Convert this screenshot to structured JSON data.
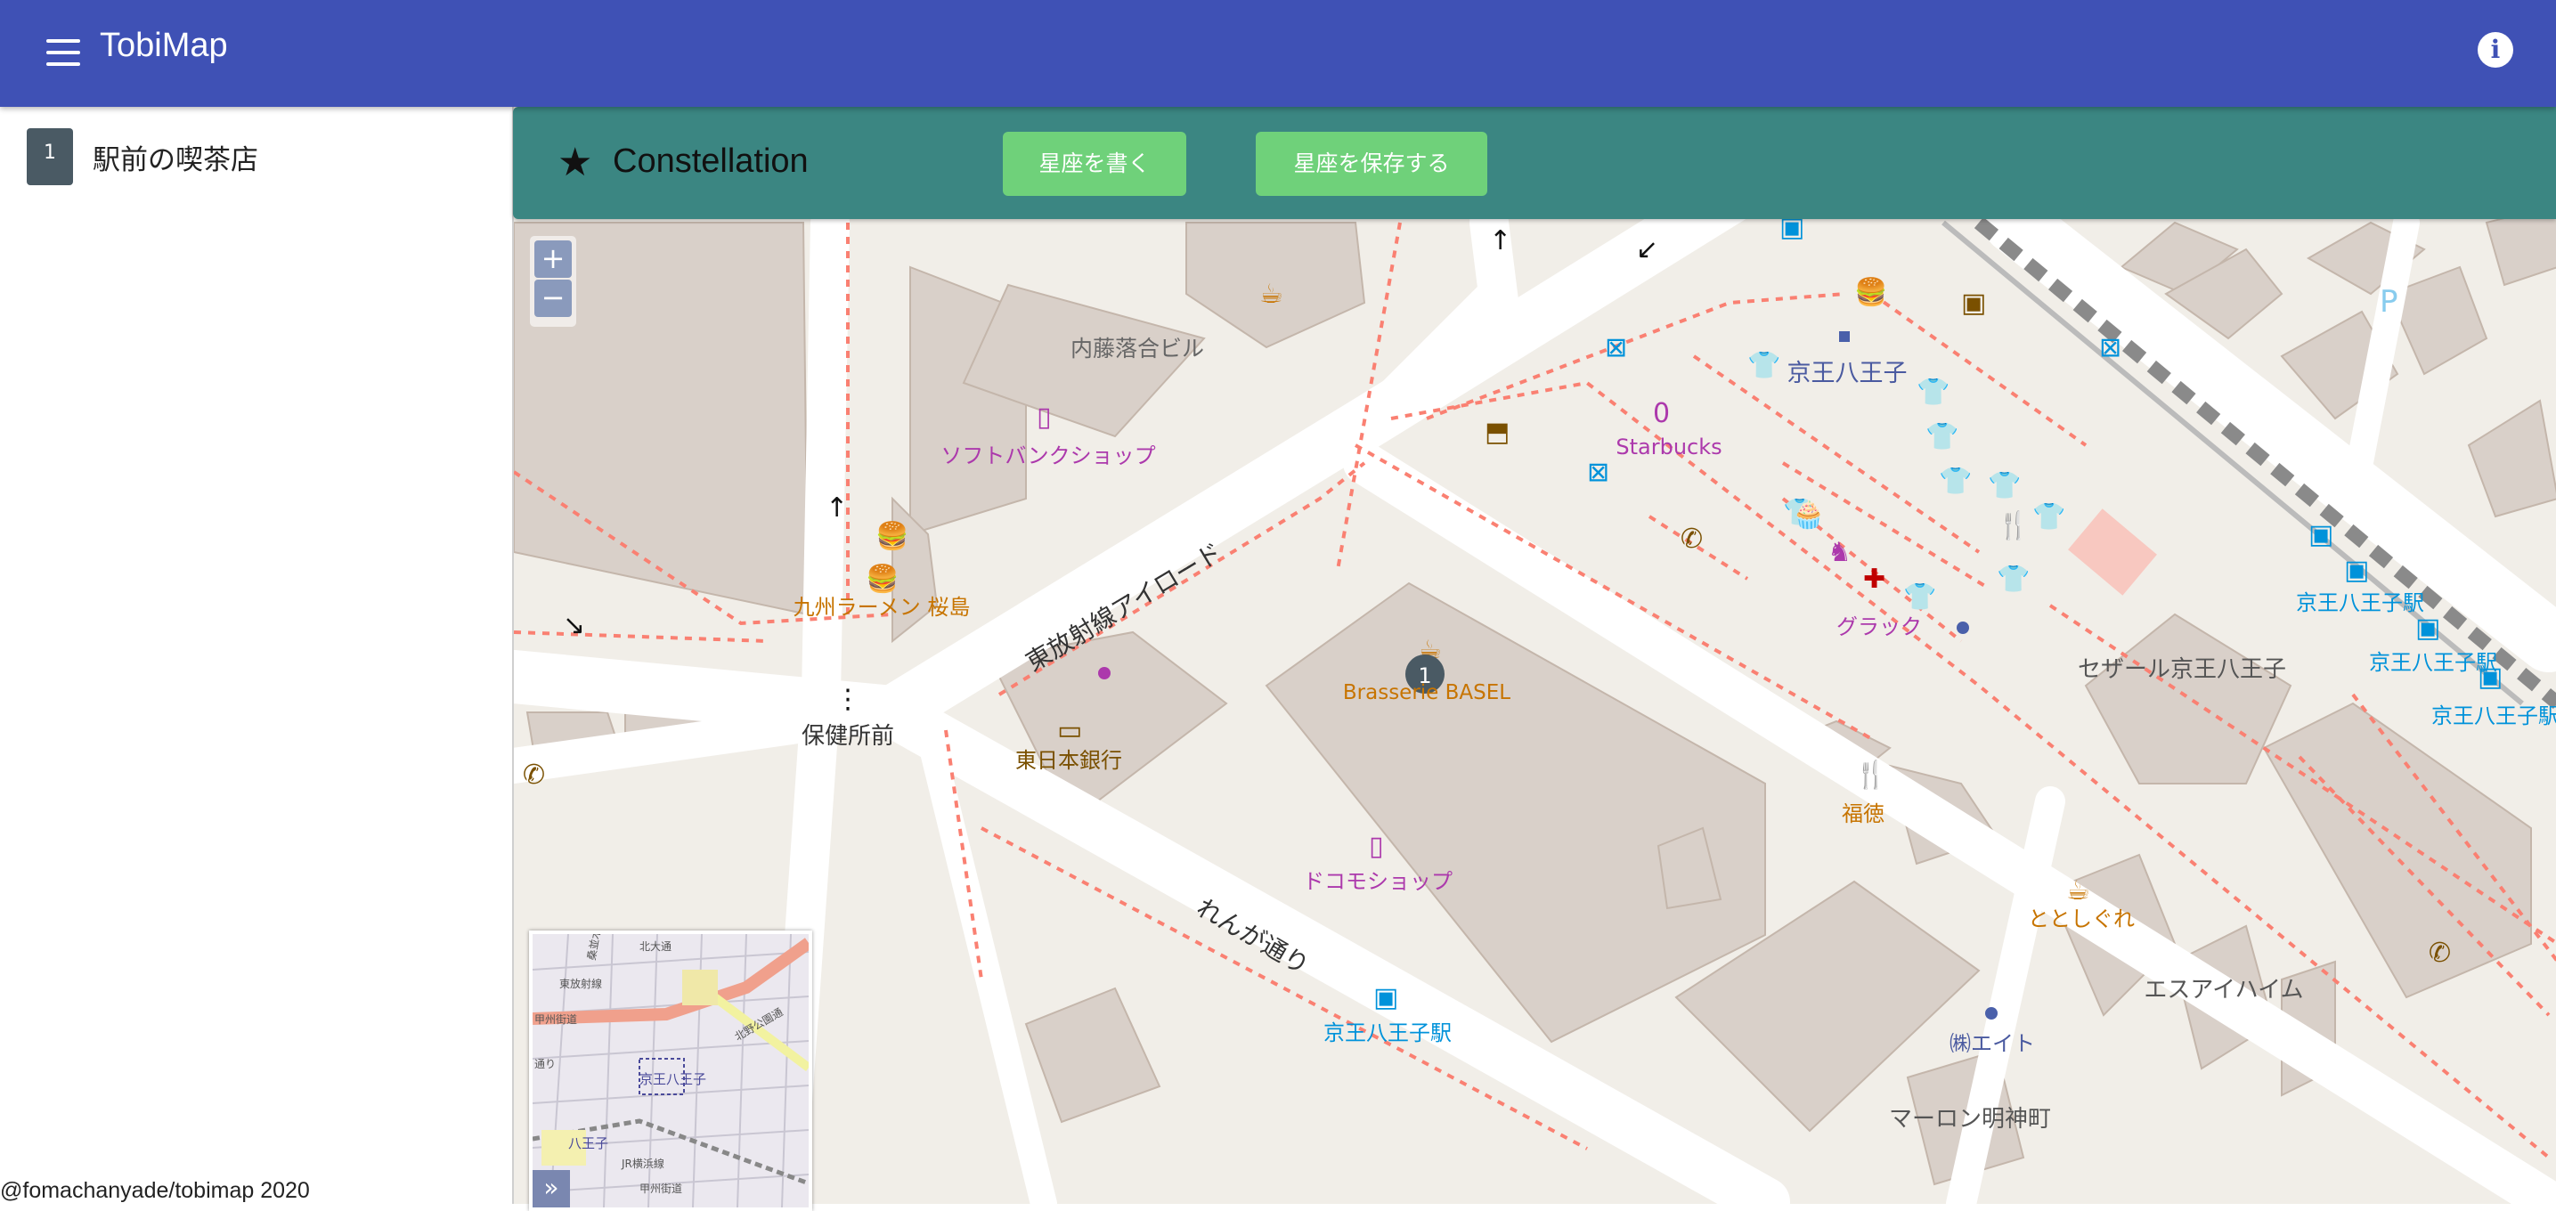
{
  "app": {
    "title": "TobiMap"
  },
  "header": {
    "menu_icon": "hamburger-menu-icon",
    "info_icon": "info-icon"
  },
  "sidebar": {
    "items": [
      {
        "number": "1",
        "label": "駅前の喫茶店"
      }
    ],
    "credit": "@fomachanyade/tobimap 2020"
  },
  "constellation": {
    "title": "Constellation",
    "icon": "star-icon",
    "draw_button": "星座を書く",
    "save_button": "星座を保存する"
  },
  "map": {
    "zoom_in": "+",
    "zoom_out": "−",
    "marker_number": "1",
    "roads": {
      "diagonal_main": "東放射線アイロード",
      "renga": "れんが通り"
    },
    "labels": {
      "naito": "内藤落合ビル",
      "softbank": "ソフトバンクショップ",
      "kyushu": "九州ラーメン 桜島",
      "hokenjo": "保健所前",
      "higashi_bank": "東日本銀行",
      "brasserie": "Brasserie BASEL",
      "docomo": "ドコモショップ",
      "keio_bus": "京王八王子駅",
      "starbucks": "Starbucks",
      "keio_hachioji": "京王八王子",
      "gurakku": "グラック",
      "fukutoku": "福徳",
      "cellar": "セザール京王八王子",
      "totoshigure": "ととしぐれ",
      "eight": "㈱エイト",
      "esa": "エスアイハイム",
      "maronn": "マーロン明神町",
      "keio_st1": "京王八王子駅",
      "keio_st2": "京王八王子駅",
      "keio_st3": "京王八王子駅",
      "parking": "P"
    },
    "minimap": {
      "toggle": "»",
      "labels": [
        "北大通",
        "東放射線",
        "北野公園通",
        "京王八王子",
        "八王子",
        "JR横浜線",
        "甲州街道",
        "通り",
        "桑並木通り",
        "甲州街道"
      ]
    }
  },
  "colors": {
    "appbar": "#3f51b5",
    "constellation_bar": "#3b8682",
    "button": "#6fd17a",
    "map_bg": "#f1eee8",
    "building": "#d9d0c9",
    "footway": "#fa8072",
    "shop_poi": "#ac39ac",
    "food_poi": "#c77400",
    "transit_poi": "#0092da"
  }
}
